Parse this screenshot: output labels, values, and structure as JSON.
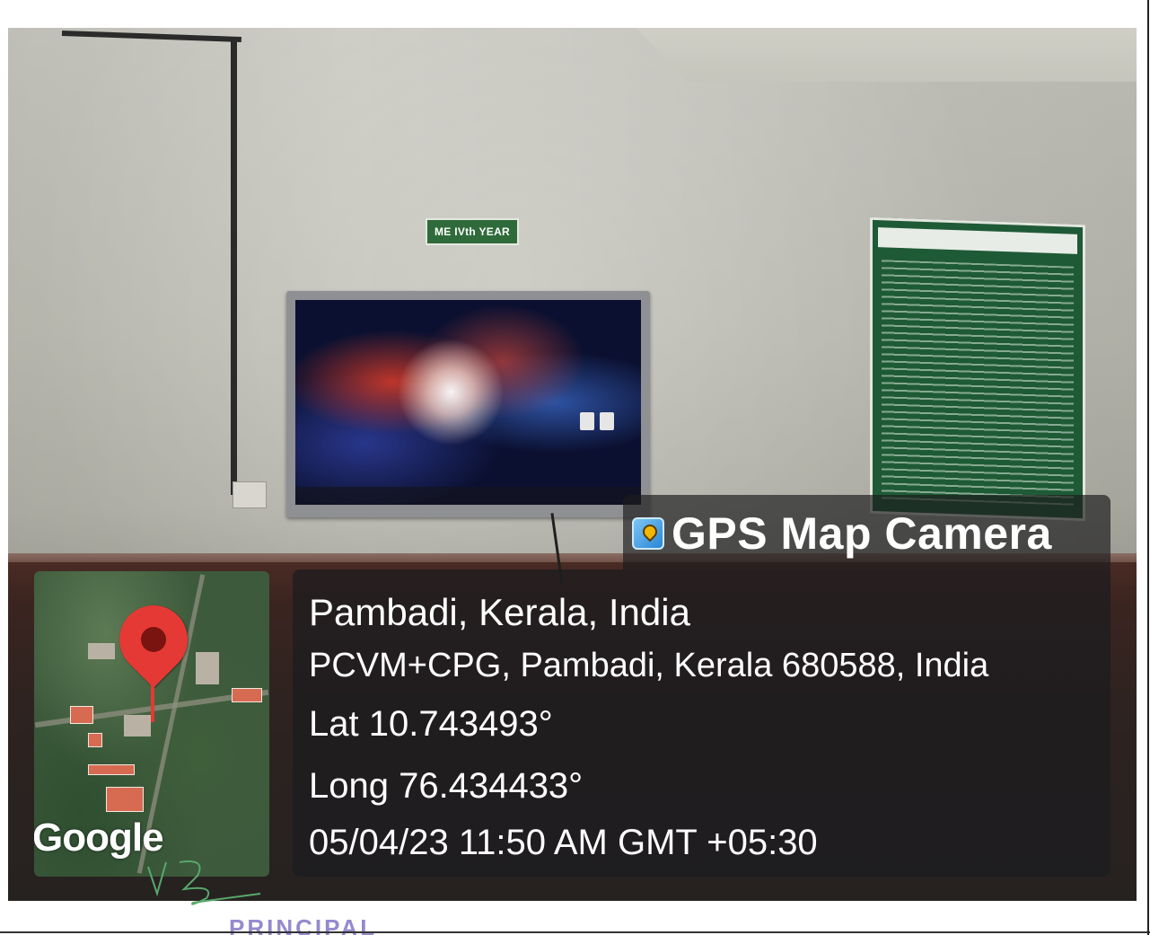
{
  "scene": {
    "sign": "ME IVth YEAR"
  },
  "overlay": {
    "app_title": "GPS Map Camera",
    "place": "Pambadi, Kerala, India",
    "address": "PCVM+CPG, Pambadi, Kerala 680588, India",
    "latitude": "Lat 10.743493°",
    "longitude": "Long 76.434433°",
    "datetime": "05/04/23 11:50 AM GMT +05:30",
    "map_brand": "Google"
  },
  "stamp": "PRINCIPAL",
  "colors": {
    "overlay_bg": "#1c1c1e",
    "pin": "#e53935",
    "stamp": "#7b6dc2"
  },
  "icons": [
    "map-pin-icon",
    "app-icon"
  ]
}
